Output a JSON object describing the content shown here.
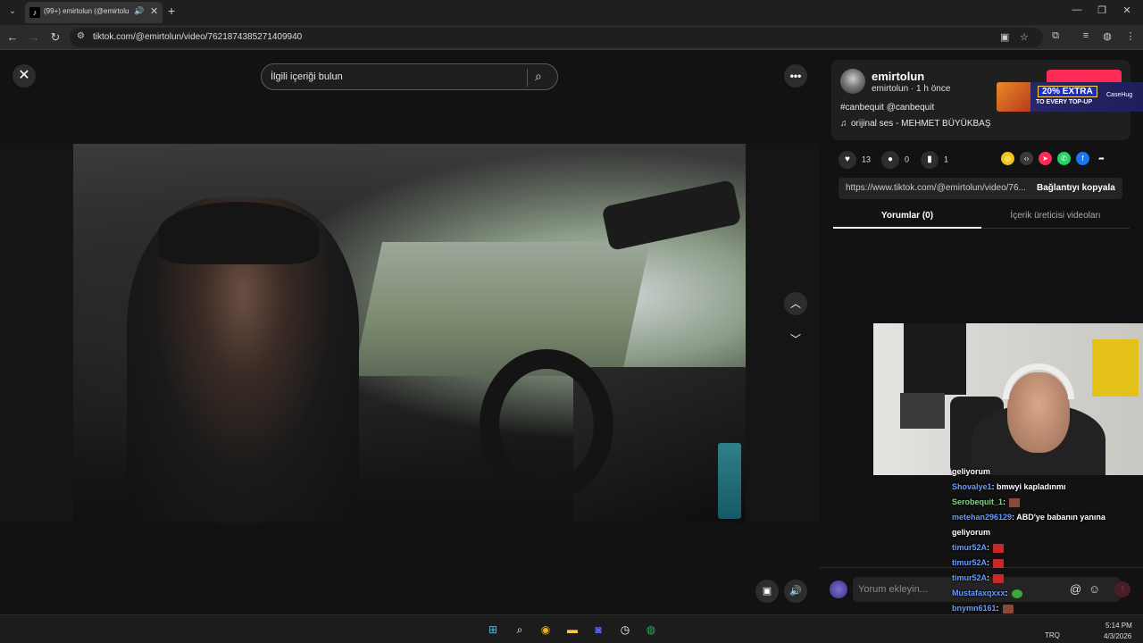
{
  "browser": {
    "tab_title": "(99+) emirtolun (@emirtolun",
    "url": "tiktok.com/@emirtolun/video/7621874385271409940",
    "icons": {
      "back": "←",
      "forward": "→",
      "reload": "↻",
      "site_info": "⚙",
      "install": "▣",
      "star": "☆",
      "extensions": "⧉",
      "media": "≡",
      "profile": "◍",
      "menu": "⋮",
      "minimize": "—",
      "restore": "❐",
      "close": "✕",
      "new_tab": "+",
      "tab_menu": "⌄",
      "tab_audio": "🔊",
      "tab_close": "✕"
    }
  },
  "player": {
    "close_icon": "✕",
    "search_placeholder": "İlgili içeriği bulun",
    "search_icon": "⌕",
    "more_icon": "•••",
    "nav_up_icon": "︿",
    "nav_down_icon": "﹀",
    "pip_icon": "▣",
    "volume_icon": "🔊"
  },
  "author": {
    "name": "emirtolun",
    "meta": "emirtolun · 1 h önce",
    "caption": "#canbequit @canbequit",
    "music": "orijinal ses - MEHMET BÜYÜKBAŞ",
    "music_icon": "♫"
  },
  "ad": {
    "line1": "20% EXTRA",
    "line2": "TO EVERY TOP-UP",
    "logo": "CaseHug"
  },
  "stats": {
    "likes": "13",
    "comments": "0",
    "saves": "1",
    "like_icon": "♥",
    "comment_icon": "●",
    "save_icon": "▮"
  },
  "share": {
    "link": "https://www.tiktok.com/@emirtolun/video/76...",
    "copy_label": "Bağlantıyı kopyala",
    "icons": [
      {
        "name": "coin",
        "glyph": "◎",
        "color": "#f0c419"
      },
      {
        "name": "embed",
        "glyph": "‹›",
        "color": "#3a3a3a"
      },
      {
        "name": "send",
        "glyph": "➤",
        "color": "#fe2c55"
      },
      {
        "name": "whatsapp",
        "glyph": "✆",
        "color": "#25d366"
      },
      {
        "name": "facebook",
        "glyph": "f",
        "color": "#1877f2"
      },
      {
        "name": "more-share",
        "glyph": "➦",
        "color": "#121212"
      }
    ]
  },
  "tabs": {
    "comments": "Yorumlar (0)",
    "creator_videos": "İçerik üreticisi videoları"
  },
  "comment_box": {
    "placeholder": "Yorum ekleyin...",
    "at_icon": "@",
    "emoji_icon": "☺",
    "send_icon": "↑"
  },
  "chat": [
    {
      "user": "",
      "text": "geliyorum",
      "emote": ""
    },
    {
      "user": "Shovalye1",
      "text": ": bmwyi kapladınmı",
      "emote": ""
    },
    {
      "user": "Serobequit_1",
      "text": ":",
      "emote": "dark"
    },
    {
      "user": "metehan296129",
      "text": ": ABD'ye babanın yanına geliyorum",
      "emote": ""
    },
    {
      "user": "timur52A",
      "text": ":",
      "emote": "red"
    },
    {
      "user": "timur52A",
      "text": ":",
      "emote": "red"
    },
    {
      "user": "timur52A",
      "text": ":",
      "emote": "red"
    },
    {
      "user": "Mustafaxqxxx",
      "text": ":",
      "emote": "green"
    },
    {
      "user": "bnymn6161",
      "text": ":",
      "emote": "dark"
    },
    {
      "user": "metehan296129",
      "text": ": ABD'ye babanın yanına geliyorum",
      "emote": ""
    }
  ],
  "taskbar": {
    "apps": [
      {
        "name": "start",
        "glyph": "⊞",
        "color": "#4cc2ff"
      },
      {
        "name": "search",
        "glyph": "⌕",
        "color": "#ffffff"
      },
      {
        "name": "chrome",
        "glyph": "◉",
        "color": "#f2b01e"
      },
      {
        "name": "explorer",
        "glyph": "▬",
        "color": "#f4c84a"
      },
      {
        "name": "discord",
        "glyph": "◙",
        "color": "#5865f2"
      },
      {
        "name": "clock",
        "glyph": "◷",
        "color": "#ffffff"
      },
      {
        "name": "spotify",
        "glyph": "◍",
        "color": "#1db954"
      }
    ],
    "lang": "TRQ",
    "time": "5:14 PM",
    "date": "4/3/2026"
  }
}
